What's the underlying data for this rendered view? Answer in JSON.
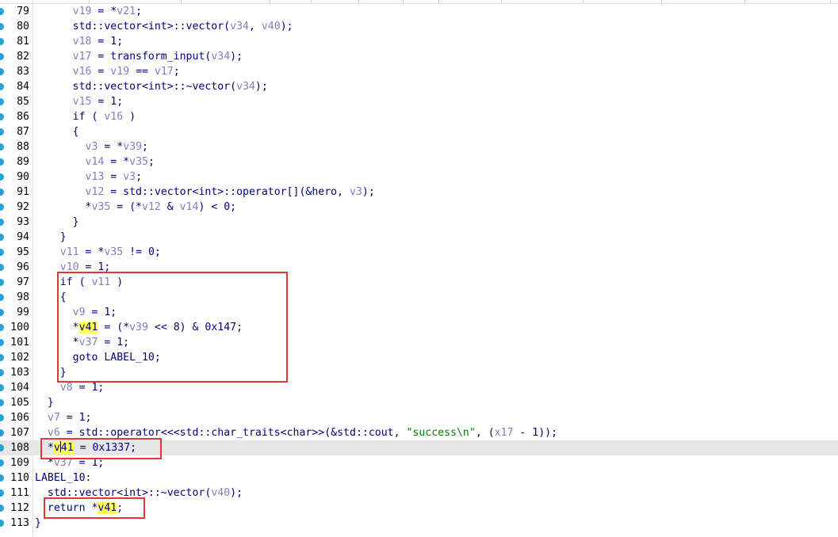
{
  "editor": {
    "current_line": 108,
    "lines": [
      {
        "n": "79",
        "tokens": [
          {
            "t": "      "
          },
          {
            "t": "v19",
            "c": "v"
          },
          {
            "t": " = *"
          },
          {
            "t": "v21",
            "c": "v"
          },
          {
            "t": ";"
          }
        ]
      },
      {
        "n": "80",
        "tokens": [
          {
            "t": "      std::vector<int>::vector("
          },
          {
            "t": "v34",
            "c": "v"
          },
          {
            "t": ", "
          },
          {
            "t": "v40",
            "c": "v"
          },
          {
            "t": ");"
          }
        ]
      },
      {
        "n": "81",
        "tokens": [
          {
            "t": "      "
          },
          {
            "t": "v18",
            "c": "v"
          },
          {
            "t": " = 1;"
          }
        ]
      },
      {
        "n": "82",
        "tokens": [
          {
            "t": "      "
          },
          {
            "t": "v17",
            "c": "v"
          },
          {
            "t": " = transform_input("
          },
          {
            "t": "v34",
            "c": "v"
          },
          {
            "t": ");"
          }
        ]
      },
      {
        "n": "83",
        "tokens": [
          {
            "t": "      "
          },
          {
            "t": "v16",
            "c": "v"
          },
          {
            "t": " = "
          },
          {
            "t": "v19",
            "c": "v"
          },
          {
            "t": " == "
          },
          {
            "t": "v17",
            "c": "v"
          },
          {
            "t": ";"
          }
        ]
      },
      {
        "n": "84",
        "tokens": [
          {
            "t": "      std::vector<int>::~vector("
          },
          {
            "t": "v34",
            "c": "v"
          },
          {
            "t": ");"
          }
        ]
      },
      {
        "n": "85",
        "tokens": [
          {
            "t": "      "
          },
          {
            "t": "v15",
            "c": "v"
          },
          {
            "t": " = 1;"
          }
        ]
      },
      {
        "n": "86",
        "tokens": [
          {
            "t": "      if ( "
          },
          {
            "t": "v16",
            "c": "v"
          },
          {
            "t": " )"
          }
        ]
      },
      {
        "n": "87",
        "tokens": [
          {
            "t": "      {"
          }
        ]
      },
      {
        "n": "88",
        "tokens": [
          {
            "t": "        "
          },
          {
            "t": "v3",
            "c": "v"
          },
          {
            "t": " = *"
          },
          {
            "t": "v39",
            "c": "v"
          },
          {
            "t": ";"
          }
        ]
      },
      {
        "n": "89",
        "tokens": [
          {
            "t": "        "
          },
          {
            "t": "v14",
            "c": "v"
          },
          {
            "t": " = *"
          },
          {
            "t": "v35",
            "c": "v"
          },
          {
            "t": ";"
          }
        ]
      },
      {
        "n": "90",
        "tokens": [
          {
            "t": "        "
          },
          {
            "t": "v13",
            "c": "v"
          },
          {
            "t": " = "
          },
          {
            "t": "v3",
            "c": "v"
          },
          {
            "t": ";"
          }
        ]
      },
      {
        "n": "91",
        "tokens": [
          {
            "t": "        "
          },
          {
            "t": "v12",
            "c": "v"
          },
          {
            "t": " = std::vector<int>::operator[](&hero, "
          },
          {
            "t": "v3",
            "c": "v"
          },
          {
            "t": ");"
          }
        ]
      },
      {
        "n": "92",
        "tokens": [
          {
            "t": "        *"
          },
          {
            "t": "v35",
            "c": "v"
          },
          {
            "t": " = (*"
          },
          {
            "t": "v12",
            "c": "v"
          },
          {
            "t": " & "
          },
          {
            "t": "v14",
            "c": "v"
          },
          {
            "t": ") < 0;"
          }
        ]
      },
      {
        "n": "93",
        "tokens": [
          {
            "t": "      }"
          }
        ]
      },
      {
        "n": "94",
        "tokens": [
          {
            "t": "    }"
          }
        ]
      },
      {
        "n": "95",
        "tokens": [
          {
            "t": "    "
          },
          {
            "t": "v11",
            "c": "v"
          },
          {
            "t": " = *"
          },
          {
            "t": "v35",
            "c": "v"
          },
          {
            "t": " != 0;"
          }
        ]
      },
      {
        "n": "96",
        "tokens": [
          {
            "t": "    "
          },
          {
            "t": "v10",
            "c": "v"
          },
          {
            "t": " = 1;"
          }
        ]
      },
      {
        "n": "97",
        "tokens": [
          {
            "t": "    if ( "
          },
          {
            "t": "v11",
            "c": "v"
          },
          {
            "t": " )"
          }
        ]
      },
      {
        "n": "98",
        "tokens": [
          {
            "t": "    {"
          }
        ]
      },
      {
        "n": "99",
        "tokens": [
          {
            "t": "      "
          },
          {
            "t": "v9",
            "c": "v"
          },
          {
            "t": " = 1;"
          }
        ]
      },
      {
        "n": "100",
        "tokens": [
          {
            "t": "      *"
          },
          {
            "t": "v41",
            "c": "hl"
          },
          {
            "t": " = (*"
          },
          {
            "t": "v39",
            "c": "v"
          },
          {
            "t": " << 8) & 0x147;"
          }
        ]
      },
      {
        "n": "101",
        "tokens": [
          {
            "t": "      *"
          },
          {
            "t": "v37",
            "c": "v"
          },
          {
            "t": " = 1;"
          }
        ]
      },
      {
        "n": "102",
        "tokens": [
          {
            "t": "      goto LABEL_10;"
          }
        ]
      },
      {
        "n": "103",
        "tokens": [
          {
            "t": "    }"
          }
        ]
      },
      {
        "n": "104",
        "tokens": [
          {
            "t": "    "
          },
          {
            "t": "v8",
            "c": "v"
          },
          {
            "t": " = 1;"
          }
        ]
      },
      {
        "n": "105",
        "tokens": [
          {
            "t": "  }"
          }
        ]
      },
      {
        "n": "106",
        "tokens": [
          {
            "t": "  "
          },
          {
            "t": "v7",
            "c": "v"
          },
          {
            "t": " = 1;"
          }
        ]
      },
      {
        "n": "107",
        "tokens": [
          {
            "t": "  "
          },
          {
            "t": "v6",
            "c": "v"
          },
          {
            "t": " = std::operator<<<std::char_traits<char>>(&std::cout, "
          },
          {
            "t": "\"success\\n\"",
            "c": "s"
          },
          {
            "t": ", ("
          },
          {
            "t": "x17",
            "c": "v"
          },
          {
            "t": " - 1));"
          }
        ]
      },
      {
        "n": "108",
        "tokens": [
          {
            "t": "  *"
          },
          {
            "t": "v41",
            "c": "hl",
            "caret": true
          },
          {
            "t": " = 0x1337;"
          }
        ]
      },
      {
        "n": "109",
        "tokens": [
          {
            "t": "  *"
          },
          {
            "t": "v37",
            "c": "v"
          },
          {
            "t": " = 1;"
          }
        ]
      },
      {
        "n": "110",
        "tokens": [
          {
            "t": "LABEL_10:"
          }
        ]
      },
      {
        "n": "111",
        "tokens": [
          {
            "t": "  std::vector<int>::~vector("
          },
          {
            "t": "v40",
            "c": "v"
          },
          {
            "t": ");"
          }
        ]
      },
      {
        "n": "112",
        "tokens": [
          {
            "t": "  return *"
          },
          {
            "t": "v41",
            "c": "hl"
          },
          {
            "t": ";"
          }
        ]
      },
      {
        "n": "113",
        "tokens": [
          {
            "t": "}"
          }
        ]
      }
    ],
    "breakpoint_dot_color": "#28a0dc",
    "highlight_box_color": "#e53535",
    "highlight_boxes": [
      "if-block-97-103",
      "assignment-108",
      "return-112"
    ]
  }
}
